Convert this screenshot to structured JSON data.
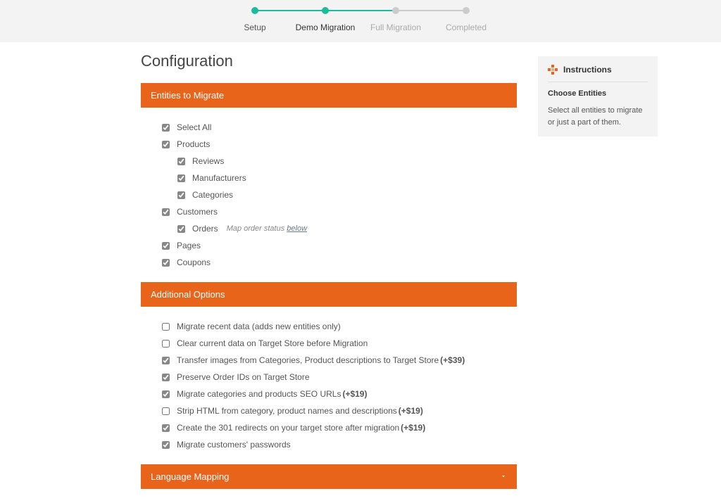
{
  "progress": {
    "steps": [
      {
        "label": "Setup",
        "active": true
      },
      {
        "label": "Demo Migration",
        "active": true,
        "current": true
      },
      {
        "label": "Full Migration",
        "active": false
      },
      {
        "label": "Completed",
        "active": false
      }
    ]
  },
  "page_title": "Configuration",
  "sections": {
    "entities": {
      "title": "Entities to Migrate",
      "items": [
        {
          "label": "Select All",
          "checked": true,
          "indent": false
        },
        {
          "label": "Products",
          "checked": true,
          "indent": false
        },
        {
          "label": "Reviews",
          "checked": true,
          "indent": true
        },
        {
          "label": "Manufacturers",
          "checked": true,
          "indent": true
        },
        {
          "label": "Categories",
          "checked": true,
          "indent": true
        },
        {
          "label": "Customers",
          "checked": true,
          "indent": false
        },
        {
          "label": "Orders",
          "checked": true,
          "indent": true,
          "note_prefix": "Map order status ",
          "note_link": "below"
        },
        {
          "label": "Pages",
          "checked": true,
          "indent": false
        },
        {
          "label": "Coupons",
          "checked": true,
          "indent": false
        }
      ]
    },
    "options": {
      "title": "Additional Options",
      "items": [
        {
          "label": "Migrate recent data (adds new entities only)",
          "checked": false
        },
        {
          "label": "Clear current data on Target Store before Migration",
          "checked": false
        },
        {
          "label": "Transfer images from Categories, Product descriptions to Target Store ",
          "suffix": "(+$39)",
          "checked": true
        },
        {
          "label": "Preserve Order IDs on Target Store",
          "checked": true
        },
        {
          "label": "Migrate categories and products SEO URLs ",
          "suffix": "(+$19)",
          "checked": true
        },
        {
          "label": "Strip HTML from category, product names and descriptions ",
          "suffix": "(+$19)",
          "checked": false
        },
        {
          "label": "Create the 301 redirects on your target store after migration ",
          "suffix": "(+$19)",
          "checked": true
        },
        {
          "label": "Migrate customers' passwords",
          "checked": true
        }
      ]
    },
    "language": {
      "title": "Language Mapping"
    }
  },
  "sidebar": {
    "title": "Instructions",
    "subtitle": "Choose Entities",
    "text": "Select all entities to migrate or just a part of them."
  }
}
